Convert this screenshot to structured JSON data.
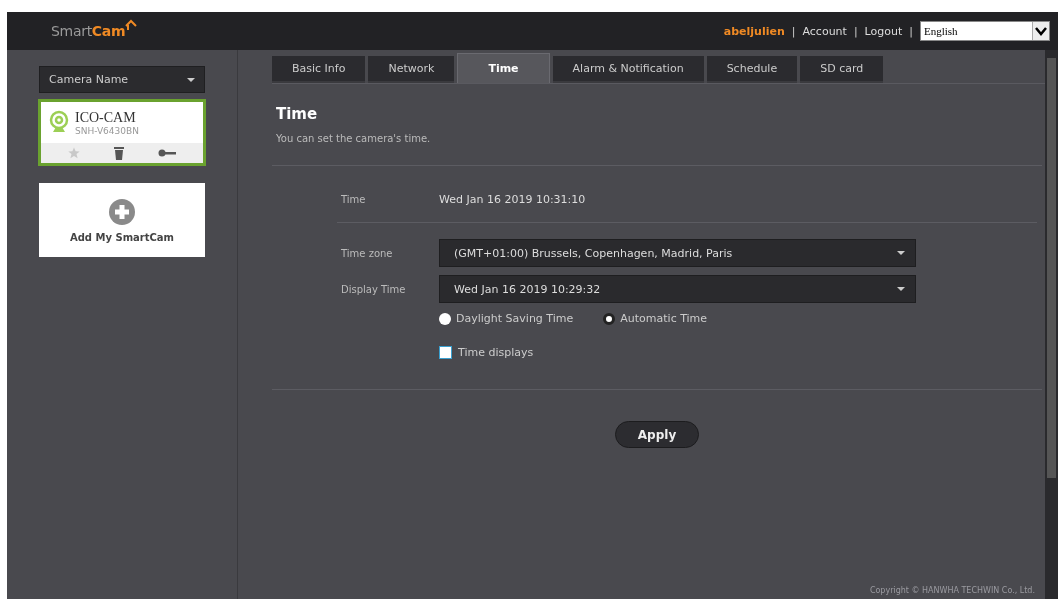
{
  "header": {
    "logo": {
      "part_1": "Smart",
      "part_2": "Cam"
    },
    "username": "abeljulien",
    "separator": "|",
    "links": [
      "Account",
      "Logout"
    ],
    "language": "English"
  },
  "sidebar": {
    "camera_select": "Camera Name",
    "cameras": [
      {
        "name": "ICO-CAM",
        "model": "SNH-V6430BN",
        "selected": true
      }
    ],
    "add_label": "Add My SmartCam"
  },
  "tabs": [
    {
      "label": "Basic Info",
      "selected": false
    },
    {
      "label": "Network",
      "selected": false
    },
    {
      "label": "Time",
      "selected": true
    },
    {
      "label": "Alarm & Notification",
      "selected": false
    },
    {
      "label": "Schedule",
      "selected": false
    },
    {
      "label": "SD card",
      "selected": false
    }
  ],
  "section": {
    "title": "Time",
    "description": "You can set the camera's time."
  },
  "form": {
    "time_label": "Time",
    "time_value": "Wed Jan 16 2019 10:31:10",
    "timezone_label": "Time zone",
    "timezone_value": "(GMT+01:00) Brussels, Copenhagen, Madrid, Paris",
    "display_label": "Display Time",
    "display_value": "Wed Jan 16 2019 10:29:32",
    "radios": [
      {
        "label": "Daylight Saving Time",
        "selected": false
      },
      {
        "label": "Automatic Time",
        "selected": true
      }
    ],
    "checkbox": {
      "label": "Time displays",
      "checked": false
    }
  },
  "apply": "Apply",
  "footer": "Copyright © HANWHA TECHWIN Co., Ltd."
}
